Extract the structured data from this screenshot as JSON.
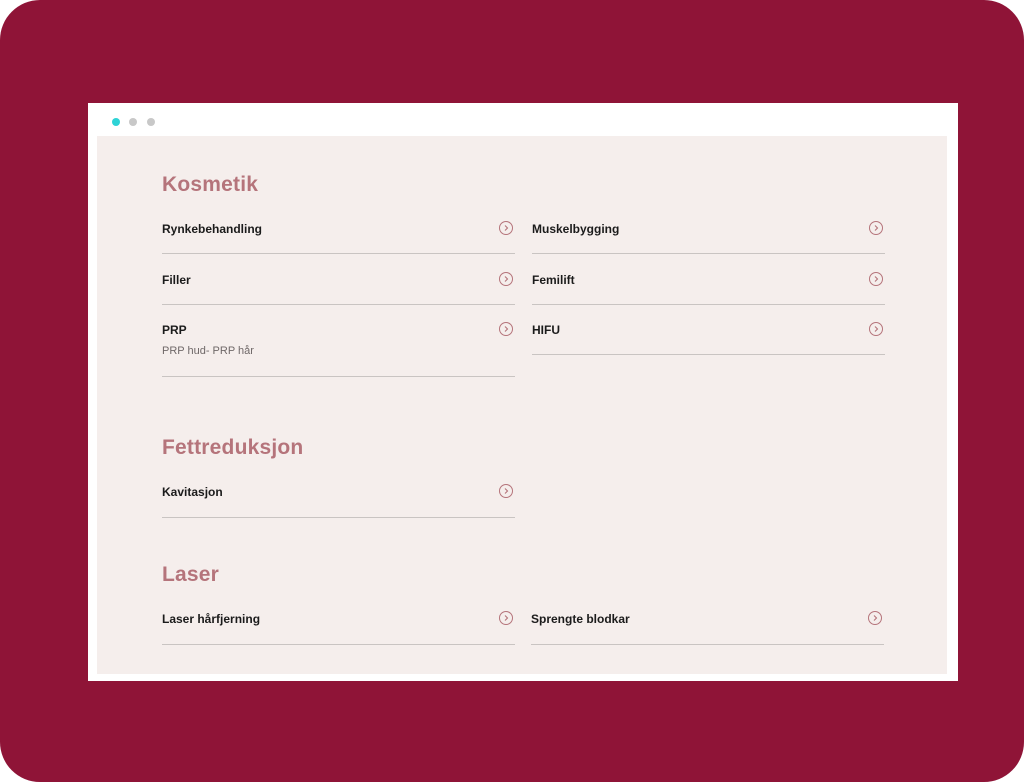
{
  "colors": {
    "frame": "#8f1437",
    "heading": "#b5747b",
    "content_bg": "#f5eeec",
    "dot_active": "#2ed3d6",
    "dot_inactive": "#c8c8c8"
  },
  "window": {
    "dots": [
      {
        "name": "window-dot-active",
        "color": "#2ed3d6"
      },
      {
        "name": "window-dot",
        "color": "#c8c8c8"
      },
      {
        "name": "window-dot",
        "color": "#c8c8c8"
      }
    ]
  },
  "sections": {
    "kosmetik": {
      "title": "Kosmetik",
      "items": [
        {
          "label": "Rynkebehandling",
          "icon": "chevron-right-circle-icon"
        },
        {
          "label": "Muskelbygging",
          "icon": "chevron-right-circle-icon"
        },
        {
          "label": "Filler",
          "icon": "chevron-right-circle-icon"
        },
        {
          "label": "Femilift",
          "icon": "chevron-right-circle-icon"
        },
        {
          "label": "PRP",
          "sub": "PRP hud- PRP hår",
          "icon": "chevron-right-circle-icon"
        },
        {
          "label": "HIFU",
          "icon": "chevron-right-circle-icon"
        }
      ]
    },
    "fettreduksjon": {
      "title": "Fettreduksjon",
      "items": [
        {
          "label": "Kavitasjon",
          "icon": "chevron-right-circle-icon"
        }
      ]
    },
    "laser": {
      "title": "Laser",
      "items": [
        {
          "label": "Laser hårfjerning",
          "icon": "chevron-right-circle-icon"
        },
        {
          "label": "Sprengte blodkar",
          "icon": "chevron-right-circle-icon"
        }
      ]
    }
  }
}
